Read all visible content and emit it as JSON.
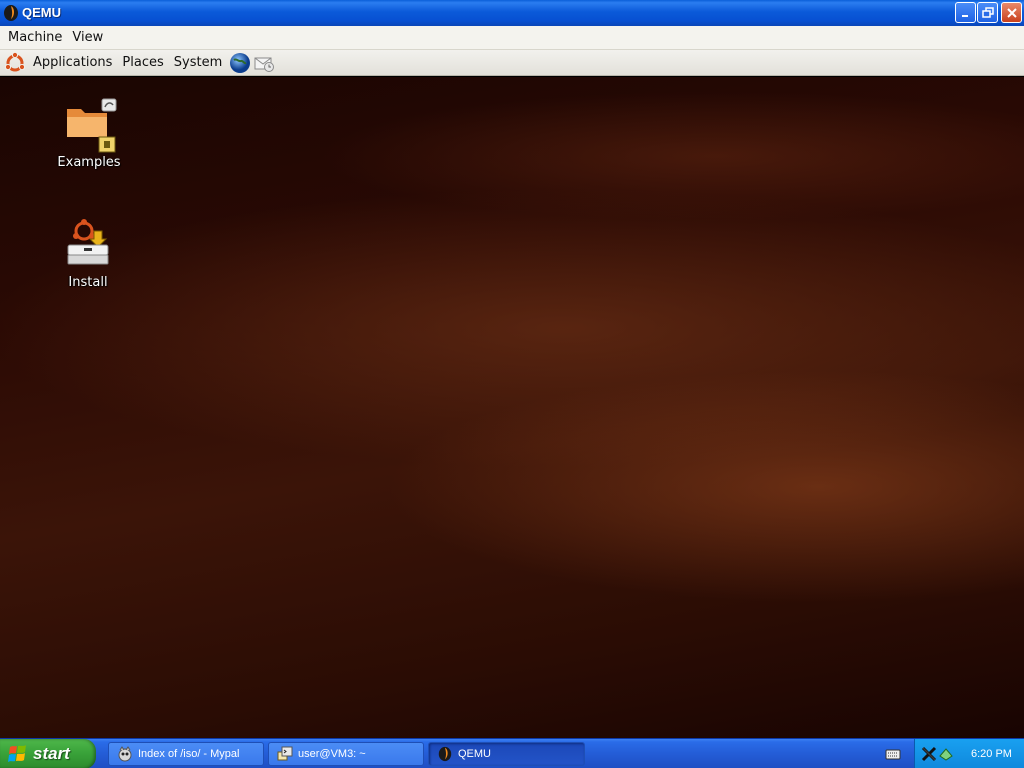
{
  "window": {
    "title": "QEMU",
    "menu": [
      "Machine",
      "View"
    ]
  },
  "gnome_panel": {
    "menus": [
      "Applications",
      "Places",
      "System"
    ],
    "launchers": [
      "web-browser-icon",
      "mail-client-icon"
    ]
  },
  "desktop": {
    "icons": [
      {
        "label": "Examples",
        "icon": "folder-icon"
      },
      {
        "label": "Install",
        "icon": "install-icon"
      }
    ]
  },
  "taskbar": {
    "start_label": "start",
    "tasks": [
      {
        "label": "Index of /iso/ - Mypal",
        "icon": "mypal-browser-icon",
        "active": false
      },
      {
        "label": "user@VM3: ~",
        "icon": "terminal-icon",
        "active": false
      },
      {
        "label": "QEMU",
        "icon": "qemu-icon",
        "active": true
      }
    ],
    "tray_clock": "6:20 PM"
  },
  "colors": {
    "xp_blue": "#245dd7",
    "start_green": "#3aa33a",
    "desktop_brown": "#3b1408"
  }
}
